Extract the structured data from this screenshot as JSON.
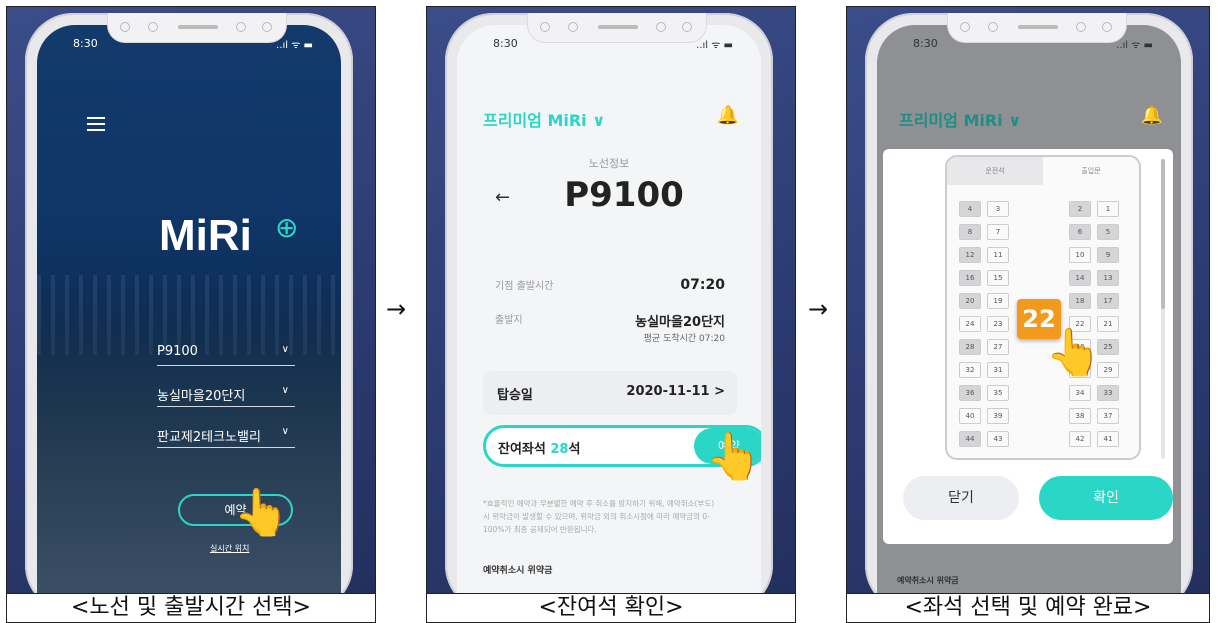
{
  "captions": [
    "<노선 및 출발시간 선택>",
    "<잔여석 확인>",
    "<좌석 선택 및 예약 완료>"
  ],
  "arrows": [
    "→",
    "→"
  ],
  "status": {
    "time": "8:30",
    "signal": "..ıl ᯤ ▬"
  },
  "panel1": {
    "logo": "MiRi",
    "route": "P9100",
    "origin": "농실마을20단지",
    "destination": "판교제2테크노밸리",
    "reserve_label": "예약",
    "live_location": "실시간 위치"
  },
  "panel2": {
    "brand": "프리미엄 MiRi ∨",
    "section": "노선정보",
    "route": "P9100",
    "first_departure_label": "기점 출발시간",
    "first_departure_time": "07:20",
    "origin_label": "출발지",
    "origin_value": "농실마을20단지",
    "arrival_note": "평균 도착시간 07:20",
    "boarding_label": "탑승일",
    "boarding_date": "2020-11-11 >",
    "remaining_label": "잔여좌석",
    "remaining_count": "28",
    "remaining_unit": "석",
    "reserve_label": "예약",
    "notice": "*효율적인 예약과 무분별한 예약 후 취소를 방지하기 위해, 예약취소(부도)시 위약금이 발생할 수 있으며, 위약금 외의 취소시점에 따라 예약금의 0-100%가 최종 공제되어 반환됩니다.",
    "penalty_title": "예약취소시 위약금"
  },
  "panel3": {
    "brand": "프리미엄 MiRi ∨",
    "tab_front": "운전석",
    "tab_door": "출입문",
    "seats_left": [
      [
        "4",
        "3"
      ],
      [
        "8",
        "7"
      ],
      [
        "12",
        "11"
      ],
      [
        "16",
        "15"
      ],
      [
        "20",
        "19"
      ],
      [
        "24",
        "23"
      ],
      [
        "28",
        "27"
      ],
      [
        "32",
        "31"
      ],
      [
        "36",
        "35"
      ],
      [
        "40",
        "39"
      ],
      [
        "44",
        "43"
      ]
    ],
    "seats_right": [
      [
        "2",
        "1"
      ],
      [
        "6",
        "5"
      ],
      [
        "10",
        "9"
      ],
      [
        "14",
        "13"
      ],
      [
        "18",
        "17"
      ],
      [
        "22",
        "21"
      ],
      [
        "26",
        "25"
      ],
      [
        "30",
        "29"
      ],
      [
        "34",
        "33"
      ],
      [
        "38",
        "37"
      ],
      [
        "42",
        "41"
      ]
    ],
    "selected_seat": "22",
    "close_label": "닫기",
    "confirm_label": "확인",
    "penalty_title": "예약취소시 위약금"
  },
  "colors": {
    "accent": "#2ad6c6",
    "selected": "#f39a1e",
    "background": "#2b3a70"
  }
}
